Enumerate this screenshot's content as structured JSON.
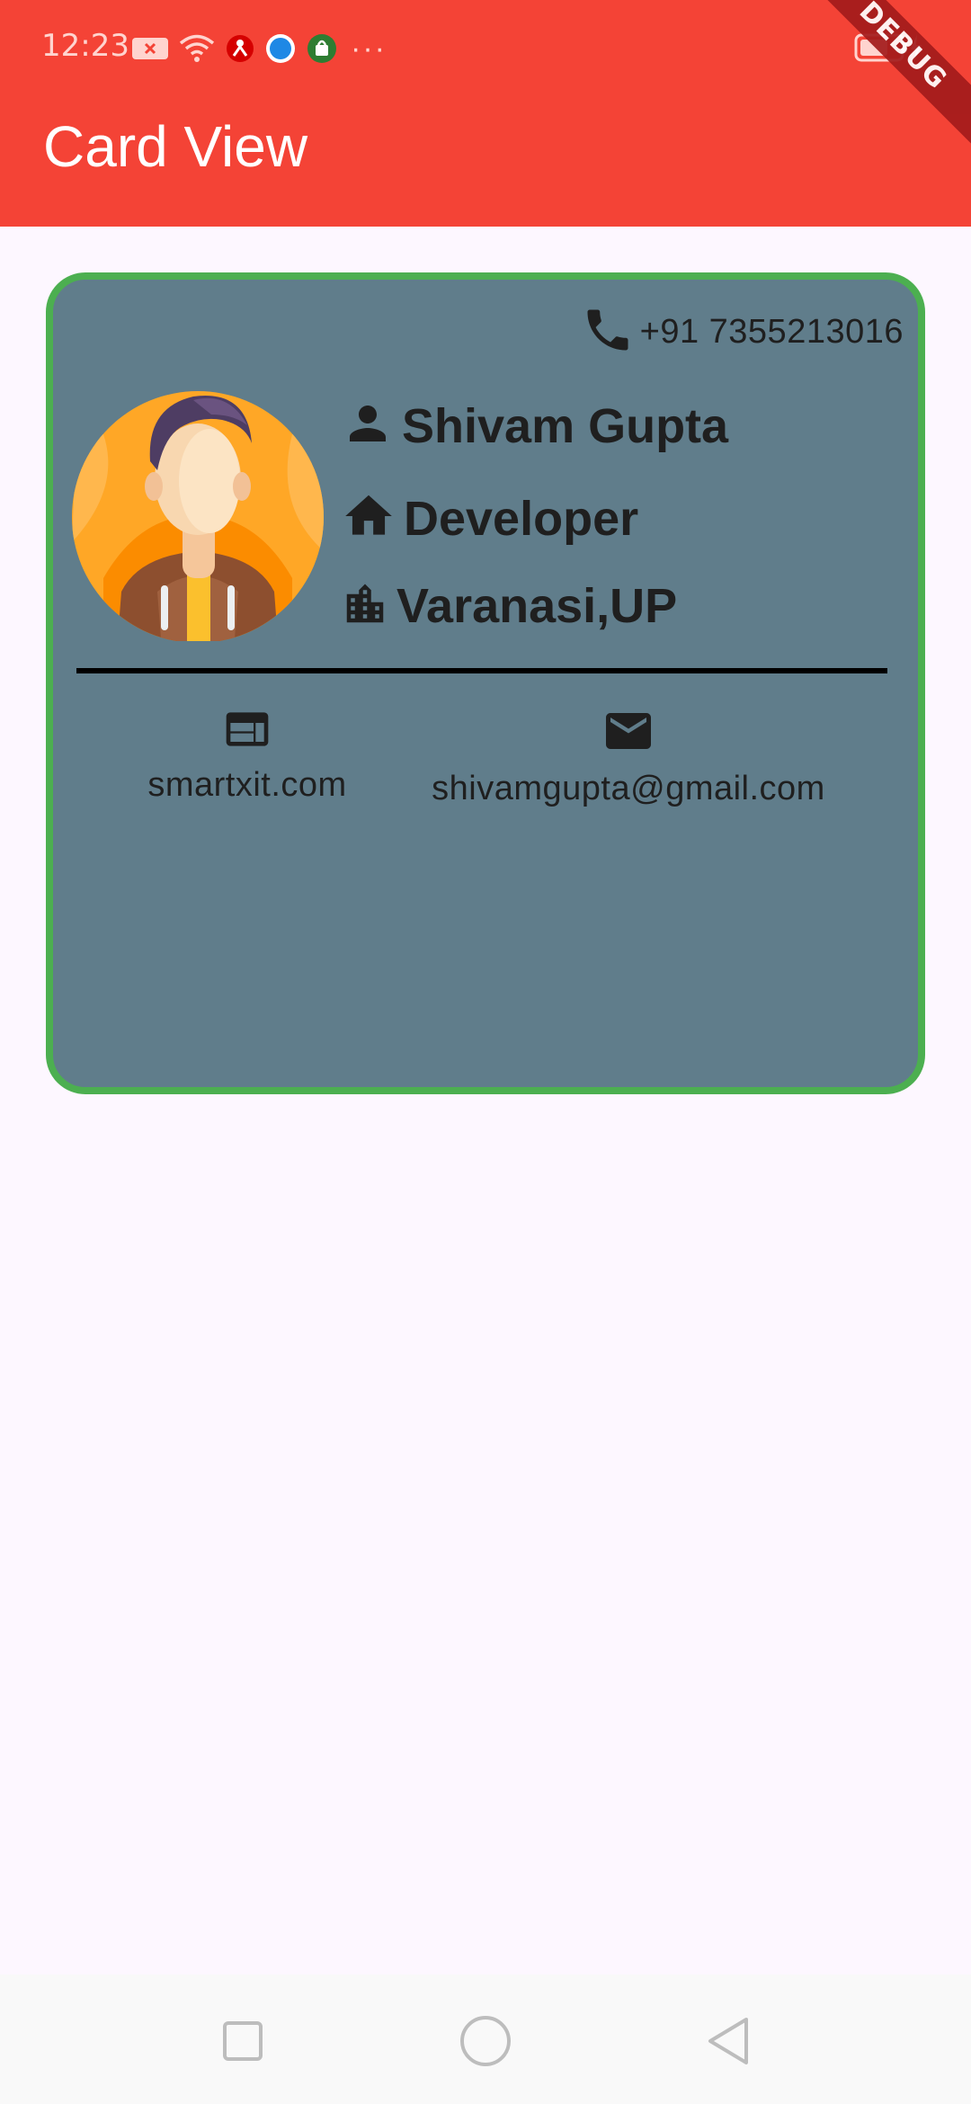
{
  "status_bar": {
    "time": "12:23",
    "icons": [
      "sim-error-icon",
      "wifi-icon",
      "app-notification-icon",
      "browser-icon",
      "store-icon",
      "more-dots-icon"
    ],
    "overflow": "···",
    "battery": "battery-charging-icon"
  },
  "app_bar": {
    "title": "Card View",
    "color": "#f44336"
  },
  "debug_banner": "DEBUG",
  "card": {
    "border_color": "#4caf50",
    "background": "#607d8b",
    "phone": "+91 7355213016",
    "name": "Shivam Gupta",
    "role": "Developer",
    "location": "Varanasi,UP",
    "website": "smartxit.com",
    "email": "shivamgupta@gmail.com",
    "icons": {
      "phone": "phone-icon",
      "name": "person-icon",
      "role": "home-icon",
      "location": "city-icon",
      "website": "web-icon",
      "email": "email-icon"
    }
  },
  "nav_bar": {
    "buttons": [
      "recents-button",
      "home-button",
      "back-button"
    ]
  }
}
